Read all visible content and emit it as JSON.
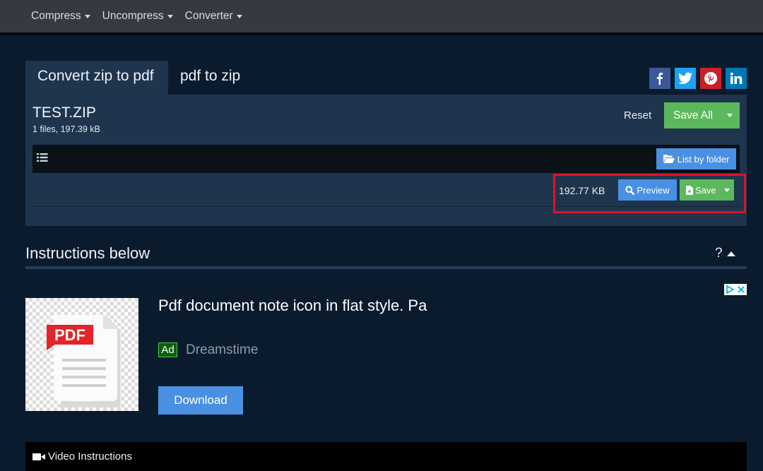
{
  "nav": {
    "items": [
      {
        "label": "Compress"
      },
      {
        "label": "Uncompress"
      },
      {
        "label": "Converter"
      }
    ]
  },
  "tabs": {
    "active": "Convert zip to pdf",
    "inactive": "pdf to zip"
  },
  "social": [
    {
      "name": "facebook-icon",
      "color": "#3b5998",
      "glyph": "f"
    },
    {
      "name": "twitter-icon",
      "color": "#1da1f2"
    },
    {
      "name": "pinterest-icon",
      "color": "#cb2027",
      "glyph": "P"
    },
    {
      "name": "linkedin-icon",
      "color": "#0077b5",
      "glyph": "in"
    }
  ],
  "archive": {
    "title": "TEST.ZIP",
    "meta": "1 files, 197.39 kB",
    "reset_label": "Reset",
    "save_all_label": "Save All",
    "list_by_folder_label": "List by folder"
  },
  "file": {
    "size": "192.77 KB",
    "preview_label": "Preview",
    "save_label": "Save"
  },
  "instructions": {
    "title": "Instructions below",
    "toggle": "?"
  },
  "ad": {
    "headline": "Pdf document note icon in flat style. Pa",
    "badge": "Ad",
    "source": "Dreamstime",
    "download_label": "Download",
    "image_text": "PDF"
  },
  "video": {
    "label": "Video Instructions"
  },
  "colors": {
    "background": "#0b1b2e",
    "panel": "#1f344d",
    "primary": "#4a90e2",
    "success": "#5cb85c",
    "highlight": "#e0122a"
  }
}
